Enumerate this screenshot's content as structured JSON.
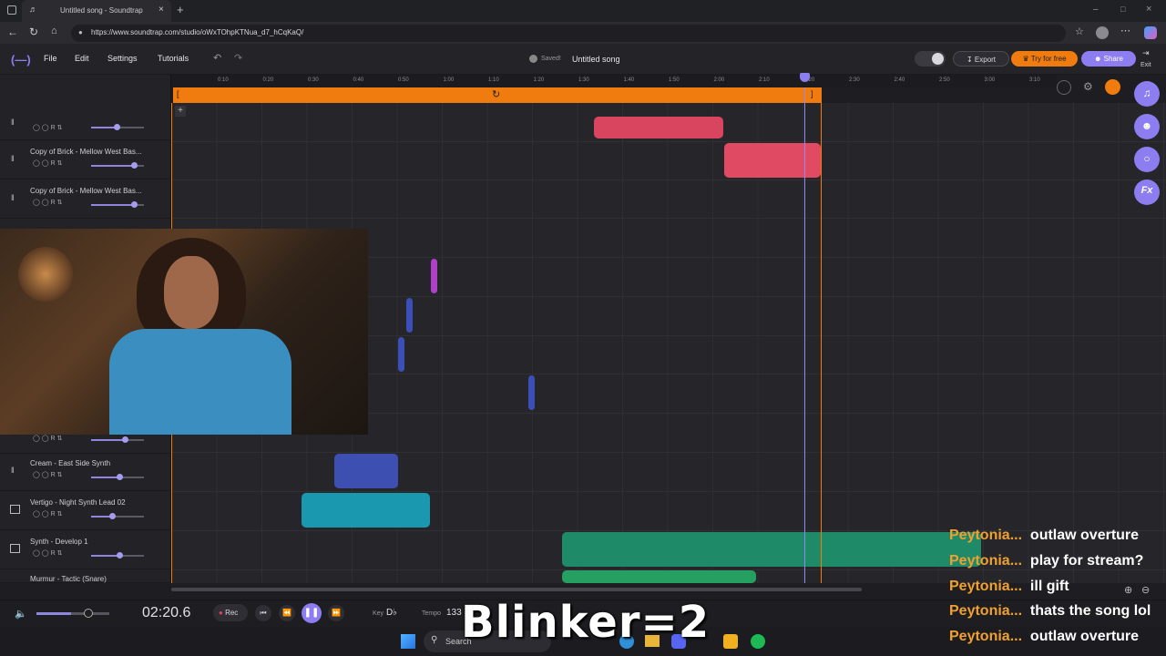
{
  "browser": {
    "tab_title": "Untitled song - Soundtrap",
    "url": "https://www.soundtrap.com/studio/oWxTOhpKTNua_d7_hCqKaQ/"
  },
  "appbar": {
    "menus": [
      "File",
      "Edit",
      "Settings",
      "Tutorials"
    ],
    "save_status": "Saved!",
    "song_title": "Untitled song",
    "export_label": "Export",
    "try_label": "Try for free",
    "share_label": "Share",
    "exit_label": "Exit",
    "brand_color": "#8c7df0",
    "accent_color": "#f07c10"
  },
  "ruler": {
    "ticks": [
      "0:10",
      "0:20",
      "0:30",
      "0:40",
      "0:50",
      "1:00",
      "1:10",
      "1:20",
      "1:30",
      "1:40",
      "1:50",
      "2:00",
      "2:10",
      "2:20",
      "2:30",
      "2:40",
      "2:50",
      "3:00",
      "3:10"
    ]
  },
  "tracks": [
    {
      "name": "",
      "controls": "R"
    },
    {
      "name": "Copy of Brick - Mellow West Bas...",
      "controls": "R"
    },
    {
      "name": "Copy of Brick - Mellow West Bas...",
      "controls": "R"
    },
    {
      "name": "Cream - East Side Synth",
      "controls": "R"
    },
    {
      "name": "Vertigo - Night Synth Lead 02",
      "controls": "R"
    },
    {
      "name": "Synth - Develop 1",
      "controls": "R"
    },
    {
      "name": "Murmur - Tactic (Snare)",
      "controls": "R"
    }
  ],
  "transport": {
    "time": "02:20.6",
    "rec_label": "Rec",
    "key_label": "Key",
    "key_value": "D♭",
    "tempo_label": "Tempo",
    "tempo_value": "133"
  },
  "taskbar": {
    "search_label": "Search"
  },
  "stream_overlay": {
    "text": "Blinker=2"
  },
  "chat": [
    {
      "user": "Peytonia...",
      "message": "outlaw overture"
    },
    {
      "user": "Peytonia...",
      "message": "play for stream?"
    },
    {
      "user": "Peytonia...",
      "message": "ill gift"
    },
    {
      "user": "Peytonia...",
      "message": "thats the song lol"
    },
    {
      "user": "Peytonia...",
      "message": "outlaw overture"
    }
  ]
}
